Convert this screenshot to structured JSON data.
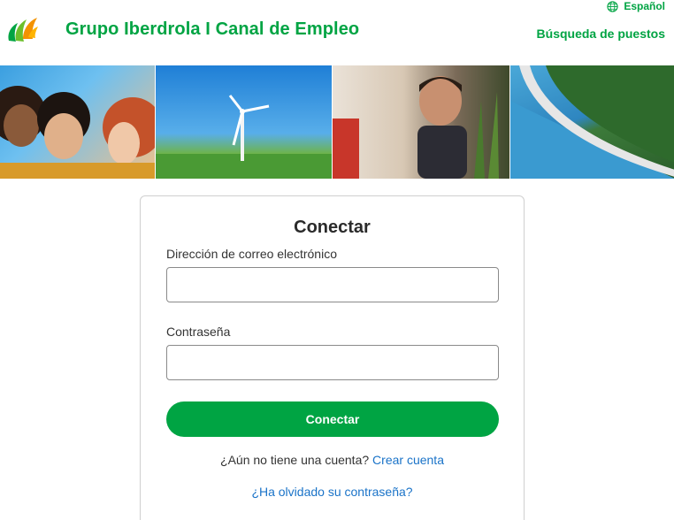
{
  "header": {
    "brand": "Grupo Iberdrola I Canal de Empleo",
    "language": "Español",
    "job_search": "Búsqueda de puestos",
    "logo_icon": "iberdrola-leaf-logo-icon",
    "globe_icon": "globe-icon",
    "brand_color": "#00a443"
  },
  "banner": {
    "images": [
      "people-smiling-image",
      "wind-turbine-image",
      "man-with-plant-image",
      "dam-aerial-image"
    ]
  },
  "login": {
    "title": "Conectar",
    "email_label": "Dirección de correo electrónico",
    "email_value": "",
    "password_label": "Contraseña",
    "password_value": "",
    "submit_label": "Conectar",
    "no_account_text": "¿Aún no tiene una cuenta?",
    "create_account_link": "Crear cuenta",
    "forgot_password_link": "¿Ha olvidado su contraseña?",
    "link_color": "#1a73c8"
  }
}
